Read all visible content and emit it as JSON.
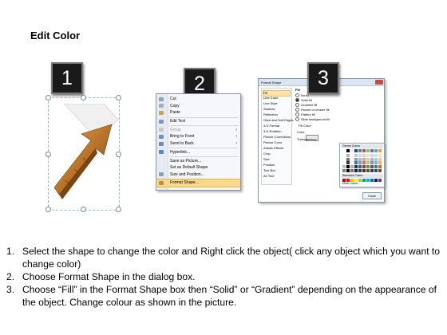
{
  "page": {
    "title": "Edit Color"
  },
  "steps": [
    "1",
    "2",
    "3"
  ],
  "context_menu": {
    "items": [
      {
        "label": "Cut",
        "icon": "scissors-icon",
        "disabled": false,
        "submenu": false
      },
      {
        "label": "Copy",
        "icon": "copy-icon",
        "disabled": false,
        "submenu": false
      },
      {
        "label": "Paste",
        "icon": "paste-icon",
        "disabled": false,
        "submenu": false
      },
      {
        "label": "Edit Text",
        "icon": "edit-text-icon",
        "disabled": false,
        "submenu": false
      },
      {
        "label": "Group",
        "icon": "group-icon",
        "disabled": true,
        "submenu": true
      },
      {
        "label": "Bring to Front",
        "icon": "bring-front-icon",
        "disabled": false,
        "submenu": true
      },
      {
        "label": "Send to Back",
        "icon": "send-back-icon",
        "disabled": false,
        "submenu": true
      },
      {
        "label": "Hyperlink...",
        "icon": "hyperlink-icon",
        "disabled": false,
        "submenu": false
      },
      {
        "label": "Save as Picture...",
        "icon": "",
        "disabled": false,
        "submenu": false
      },
      {
        "label": "Set as Default Shape",
        "icon": "",
        "disabled": false,
        "submenu": false
      },
      {
        "label": "Size and Position...",
        "icon": "size-icon",
        "disabled": false,
        "submenu": false
      },
      {
        "label": "Format Shape...",
        "icon": "format-shape-icon",
        "disabled": false,
        "submenu": false,
        "highlighted": true
      }
    ]
  },
  "dialog": {
    "title": "Format Shape",
    "nav": [
      "Fill",
      "Line Color",
      "Line Style",
      "Shadow",
      "Reflection",
      "Glow and Soft Edges",
      "3-D Format",
      "3-D Rotation",
      "Picture Corrections",
      "Picture Color",
      "Artistic Effects",
      "Crop",
      "Size",
      "Position",
      "Text Box",
      "Alt Text"
    ],
    "fill_heading": "Fill",
    "fill_options": [
      "No fill",
      "Solid fill",
      "Gradient fill",
      "Picture or texture fill",
      "Pattern fill",
      "Slide background fill"
    ],
    "fill_color_label": "Fill Color",
    "color_label": "Color:",
    "transparency_label": "Transparency:",
    "theme_colors_label": "Theme Colors",
    "standard_colors_label": "Standard Colors",
    "more_colors_label": "More Colors...",
    "close_label": "Close"
  },
  "instructions": [
    {
      "num": "1.",
      "text": "Select the shape to change the color and Right click the object( click any object which you want to change color)"
    },
    {
      "num": "2.",
      "text": "Choose Format Shape in the dialog box."
    },
    {
      "num": "3.",
      "text": "Choose “Fill” in the Format Shape box then “Solid” or “Gradient” depending on the appearance of the object. Change colour as shown in the picture."
    }
  ]
}
